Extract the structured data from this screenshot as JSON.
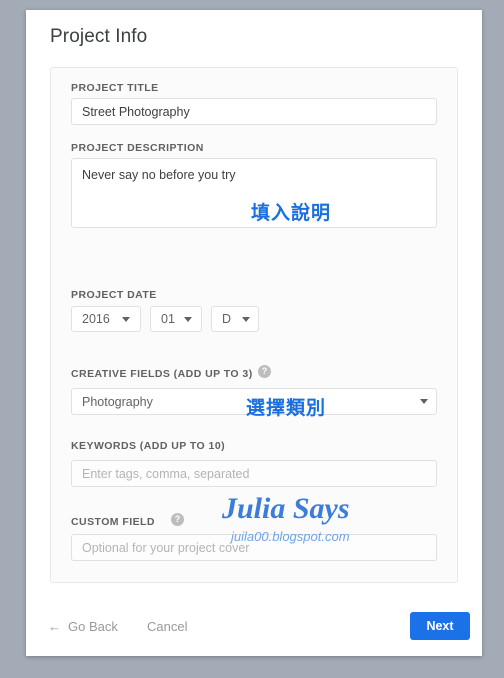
{
  "page": {
    "title": "Project Info"
  },
  "form": {
    "project_title": {
      "label": "PROJECT TITLE",
      "value": "Street Photography"
    },
    "project_description": {
      "label": "PROJECT DESCRIPTION",
      "value": "Never say no before you try",
      "annotation": "填入說明"
    },
    "project_date": {
      "label": "PROJECT DATE",
      "year": "2016",
      "month": "01",
      "day": "D"
    },
    "creative_fields": {
      "label": "CREATIVE FIELDS (ADD UP TO 3)",
      "help": "?",
      "value": "Photography",
      "annotation": "選擇類別"
    },
    "keywords": {
      "label": "KEYWORDS (ADD UP TO 10)",
      "placeholder": "Enter tags, comma, separated"
    },
    "custom_field": {
      "label": "CUSTOM FIELD",
      "help": "?",
      "placeholder": "Optional for your project cover"
    }
  },
  "watermark": {
    "title": "Julia Says",
    "url": "juila00.blogspot.com"
  },
  "footer": {
    "back_arrow": "←",
    "go_back": "Go Back",
    "cancel": "Cancel",
    "next": "Next"
  },
  "colors": {
    "accent": "#1b72e8",
    "annotation": "#1a6fe0",
    "watermark": "#3b7dd8",
    "background": "#a3abb6"
  }
}
